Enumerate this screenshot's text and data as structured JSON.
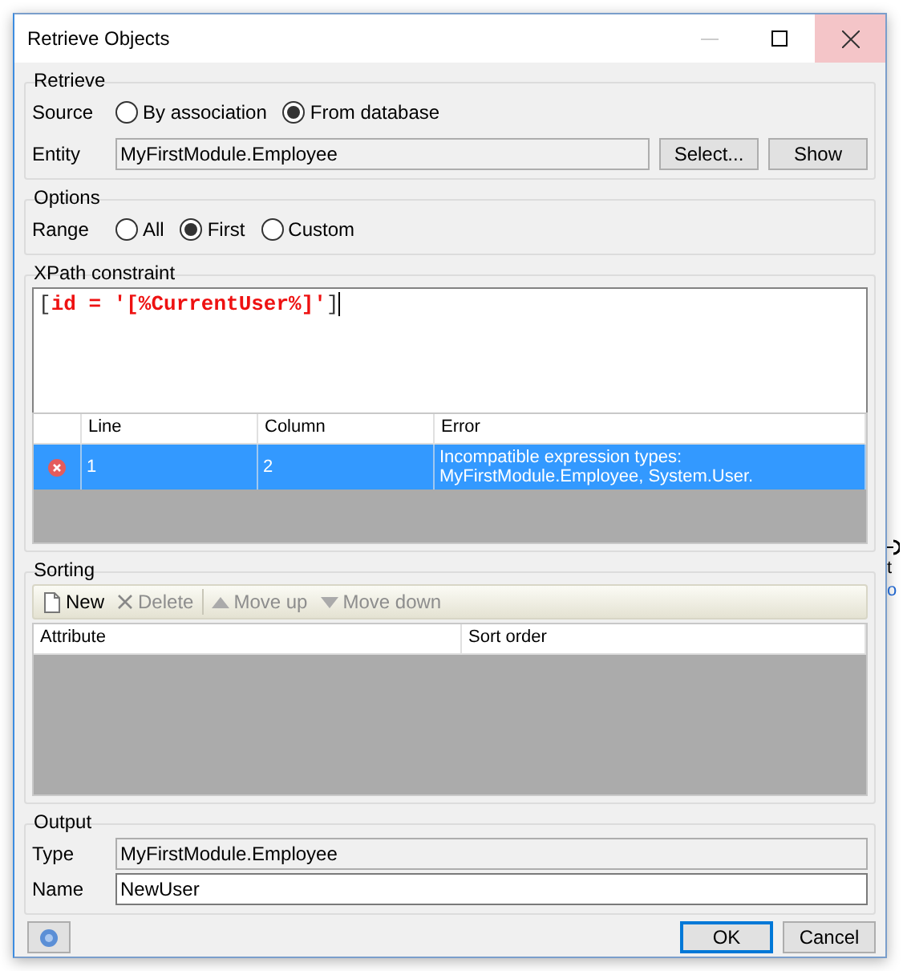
{
  "window": {
    "title": "Retrieve Objects"
  },
  "retrieve": {
    "title": "Retrieve",
    "source_label": "Source",
    "source_options": [
      {
        "label": "By association",
        "selected": false
      },
      {
        "label": "From database",
        "selected": true
      }
    ],
    "entity_label": "Entity",
    "entity_value": "MyFirstModule.Employee",
    "buttons": [
      "Select...",
      "Show"
    ]
  },
  "options": {
    "title": "Options",
    "range_label": "Range",
    "range_options": [
      {
        "label": "All",
        "selected": false
      },
      {
        "label": "First",
        "selected": true
      },
      {
        "label": "Custom",
        "selected": false
      }
    ]
  },
  "xpath": {
    "title": "XPath constraint",
    "tokens": [
      {
        "text": "[",
        "kind": "plain"
      },
      {
        "text": "id = '[%CurrentUser%]'",
        "kind": "literal"
      },
      {
        "text": "]",
        "kind": "plain"
      }
    ],
    "error_columns": [
      "Line",
      "Column",
      "Error"
    ],
    "errors": [
      {
        "kind": "error",
        "line": "1",
        "column": "2",
        "error": "Incompatible expression types: MyFirstModule.Employee, System.User.",
        "selected": true
      }
    ]
  },
  "sorting": {
    "title": "Sorting",
    "toolbar": [
      {
        "label": "New",
        "kind": "new",
        "disabled": false
      },
      {
        "label": "Delete",
        "kind": "delete",
        "disabled": true
      },
      {
        "label": "Move up",
        "kind": "up",
        "disabled": true
      },
      {
        "label": "Move down",
        "kind": "down",
        "disabled": true
      }
    ],
    "columns": [
      "Attribute",
      "Sort order"
    ]
  },
  "output": {
    "title": "Output",
    "type_label": "Type",
    "type_value": "MyFirstModule.Employee",
    "name_label": "Name",
    "name_value": "NewUser"
  },
  "footer": {
    "buttons": [
      {
        "label": "OK",
        "default": true
      },
      {
        "label": "Cancel",
        "default": false
      }
    ]
  },
  "background": {
    "texts": [
      {
        "text": "t",
        "kind": "plain"
      },
      {
        "text": "o",
        "kind": "link"
      }
    ]
  }
}
